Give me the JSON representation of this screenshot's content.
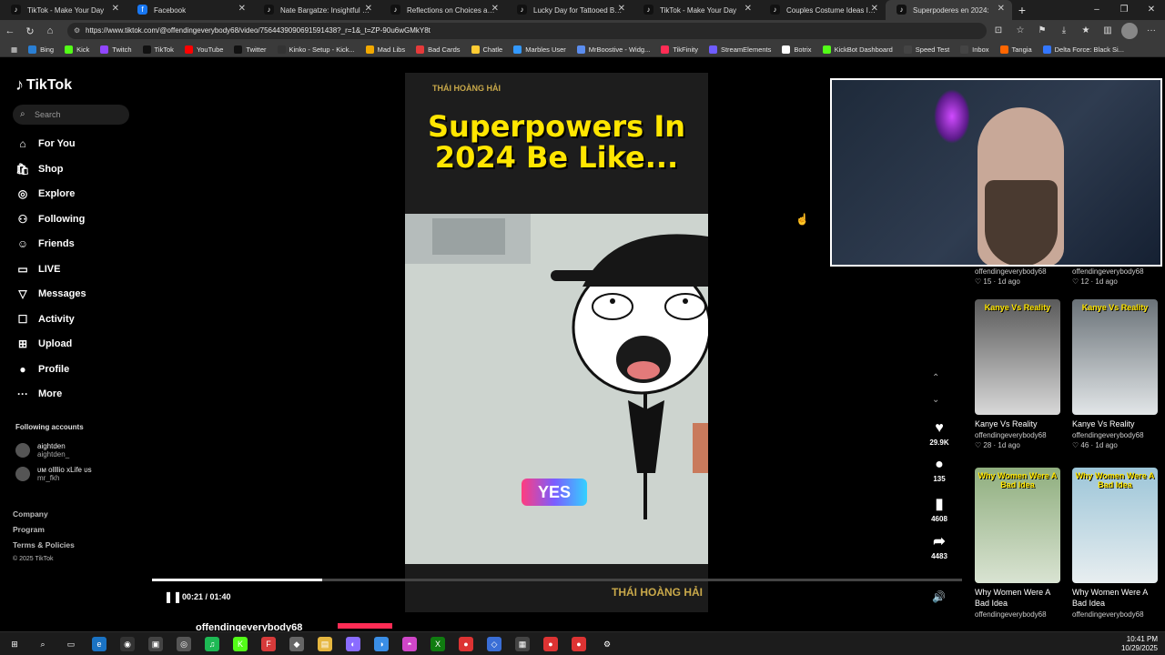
{
  "browser": {
    "tabs": [
      {
        "title": "TikTok - Make Your Day",
        "icon": "tiktok-icon",
        "color": "#111111"
      },
      {
        "title": "Facebook",
        "icon": "facebook-icon",
        "color": "#1877f2"
      },
      {
        "title": "Nate Bargatze: Insightful Stand",
        "icon": "tiktok-icon",
        "color": "#111111"
      },
      {
        "title": "Reflections on Choices and Fe",
        "icon": "tiktok-icon",
        "color": "#111111"
      },
      {
        "title": "Lucky Day for Tattooed Badas",
        "icon": "tiktok-icon",
        "color": "#111111"
      },
      {
        "title": "TikTok - Make Your Day",
        "icon": "tiktok-icon",
        "color": "#111111"
      },
      {
        "title": "Couples Costume Ideas Inspir",
        "icon": "tiktok-icon",
        "color": "#111111"
      },
      {
        "title": "Superpoderes en 2024:",
        "icon": "tiktok-icon",
        "color": "#111111",
        "active": true
      }
    ],
    "url": "https://www.tiktok.com/@offendingeverybody68/video/7564439090691591438?_r=1&_t=ZP-90u6wGMkY8t",
    "bookmarks": [
      {
        "label": "Bing",
        "color": "#2a7fd4"
      },
      {
        "label": "Kick",
        "color": "#53fc18"
      },
      {
        "label": "Twitch",
        "color": "#9146ff"
      },
      {
        "label": "TikTok",
        "color": "#111111"
      },
      {
        "label": "YouTube",
        "color": "#ff0000"
      },
      {
        "label": "Twitter",
        "color": "#111111"
      },
      {
        "label": "Kinko - Setup - Kick...",
        "color": "#333333"
      },
      {
        "label": "Mad Libs",
        "color": "#f2a900"
      },
      {
        "label": "Bad Cards",
        "color": "#e63a3a"
      },
      {
        "label": "Chatle",
        "color": "#ffcc33"
      },
      {
        "label": "Marbles User",
        "color": "#3399ff"
      },
      {
        "label": "MrBoostive - Widg...",
        "color": "#5b8def"
      },
      {
        "label": "TikFinity",
        "color": "#ff2d55"
      },
      {
        "label": "StreamElements",
        "color": "#6f5cff"
      },
      {
        "label": "Botrix",
        "color": "#ffffff"
      },
      {
        "label": "KickBot Dashboard",
        "color": "#53fc18"
      },
      {
        "label": "Speed Test",
        "color": "#444444"
      },
      {
        "label": "Inbox",
        "color": "#444444"
      },
      {
        "label": "Tangia",
        "color": "#ff6600"
      },
      {
        "label": "Delta Force: Black Si...",
        "color": "#3377ff"
      }
    ]
  },
  "sidebar": {
    "logo": "TikTok",
    "search_placeholder": "Search",
    "nav": [
      {
        "label": "For You",
        "icon": "home-icon",
        "glyph": "⌂"
      },
      {
        "label": "Shop",
        "icon": "shop-icon",
        "glyph": "🛍"
      },
      {
        "label": "Explore",
        "icon": "explore-icon",
        "glyph": "◎"
      },
      {
        "label": "Following",
        "icon": "following-icon",
        "glyph": "⚇"
      },
      {
        "label": "Friends",
        "icon": "friends-icon",
        "glyph": "☺"
      },
      {
        "label": "LIVE",
        "icon": "live-icon",
        "glyph": "▭"
      },
      {
        "label": "Messages",
        "icon": "messages-icon",
        "glyph": "▽"
      },
      {
        "label": "Activity",
        "icon": "activity-icon",
        "glyph": "☐"
      },
      {
        "label": "Upload",
        "icon": "upload-icon",
        "glyph": "⊞"
      },
      {
        "label": "Profile",
        "icon": "profile-icon",
        "glyph": "●"
      },
      {
        "label": "More",
        "icon": "more-icon",
        "glyph": "···"
      }
    ],
    "following_title": "Following accounts",
    "accounts": [
      {
        "name": "aightden",
        "handle": "aightden_"
      },
      {
        "name": "ᴜᴍ ollllio xLife ᴜs",
        "handle": "mr_fkh"
      }
    ],
    "footer": [
      "Company",
      "Program",
      "Terms & Policies"
    ],
    "copyright": "© 2025 TikTok"
  },
  "player": {
    "title_text": "Superpowers In 2024 Be Like...",
    "watermark": "THÁI HOÀNG HẢI",
    "caption": "YES",
    "current_time": "00:21",
    "duration": "01:40",
    "time_display": "00:21 / 01:40",
    "progress_fraction": 0.21,
    "author": "offendingeverybody68"
  },
  "actions": {
    "likes": "29.9K",
    "comments": "135",
    "saves": "4608",
    "shares": "4483"
  },
  "grid": {
    "cards": [
      {
        "title": "",
        "user": "offendingeverybody68",
        "likes": "15",
        "age": "1d ago",
        "thumb": "",
        "colors": [
          "#2f3a4a",
          "#1b222c"
        ]
      },
      {
        "title": "",
        "user": "offendingeverybody68",
        "likes": "12",
        "age": "1d ago",
        "thumb": "",
        "colors": [
          "#2f3a4a",
          "#1b222c"
        ]
      },
      {
        "title": "Kanye Vs Reality",
        "user": "offendingeverybody68",
        "likes": "28",
        "age": "1d ago",
        "thumb": "Kanye Vs Reality",
        "colors": [
          "#5a5a5a",
          "#d8d8d8"
        ]
      },
      {
        "title": "Kanye Vs Reality",
        "user": "offendingeverybody68",
        "likes": "46",
        "age": "1d ago",
        "thumb": "Kanye Vs Reality",
        "colors": [
          "#6a7278",
          "#e2e6e8"
        ]
      },
      {
        "title": "Why Women Were A Bad Idea",
        "user": "offendingeverybody68",
        "likes": "",
        "age": "",
        "thumb": "Why Women Were A Bad Idea",
        "colors": [
          "#8fae7e",
          "#d9e3d2"
        ]
      },
      {
        "title": "Why Women Were A Bad Idea",
        "user": "offendingeverybody68",
        "likes": "",
        "age": "",
        "thumb": "Why Women Were A Bad Idea",
        "colors": [
          "#9cc5d8",
          "#e8eef0"
        ]
      }
    ]
  },
  "taskbar": {
    "time": "10:41 PM",
    "date": "10/29/2025"
  }
}
